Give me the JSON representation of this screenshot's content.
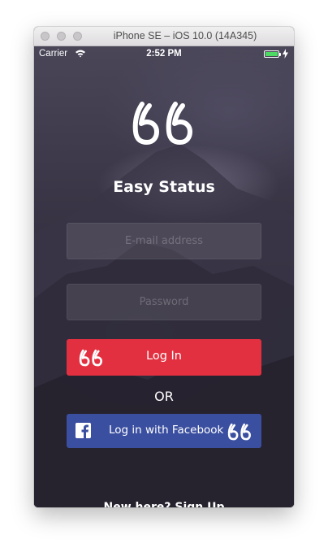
{
  "window": {
    "title": "iPhone SE – iOS 10.0 (14A345)"
  },
  "statusbar": {
    "carrier": "Carrier",
    "time": "2:52 PM",
    "battery_level": 1.0
  },
  "app": {
    "title": "Easy Status"
  },
  "form": {
    "email_placeholder": "E-mail address",
    "password_placeholder": "Password"
  },
  "buttons": {
    "login_label": "Log In",
    "or_label": "OR",
    "facebook_label": "Log in with Facebook"
  },
  "footer": {
    "signup_label": "New here? Sign Up"
  },
  "icons": {
    "logo": "quote-icon",
    "login": "quote-icon",
    "facebook": "facebook-icon"
  },
  "colors": {
    "login_button": "#e33040",
    "facebook_button": "#3b4fa0",
    "battery": "#4cd964",
    "background": "#2b2737"
  }
}
